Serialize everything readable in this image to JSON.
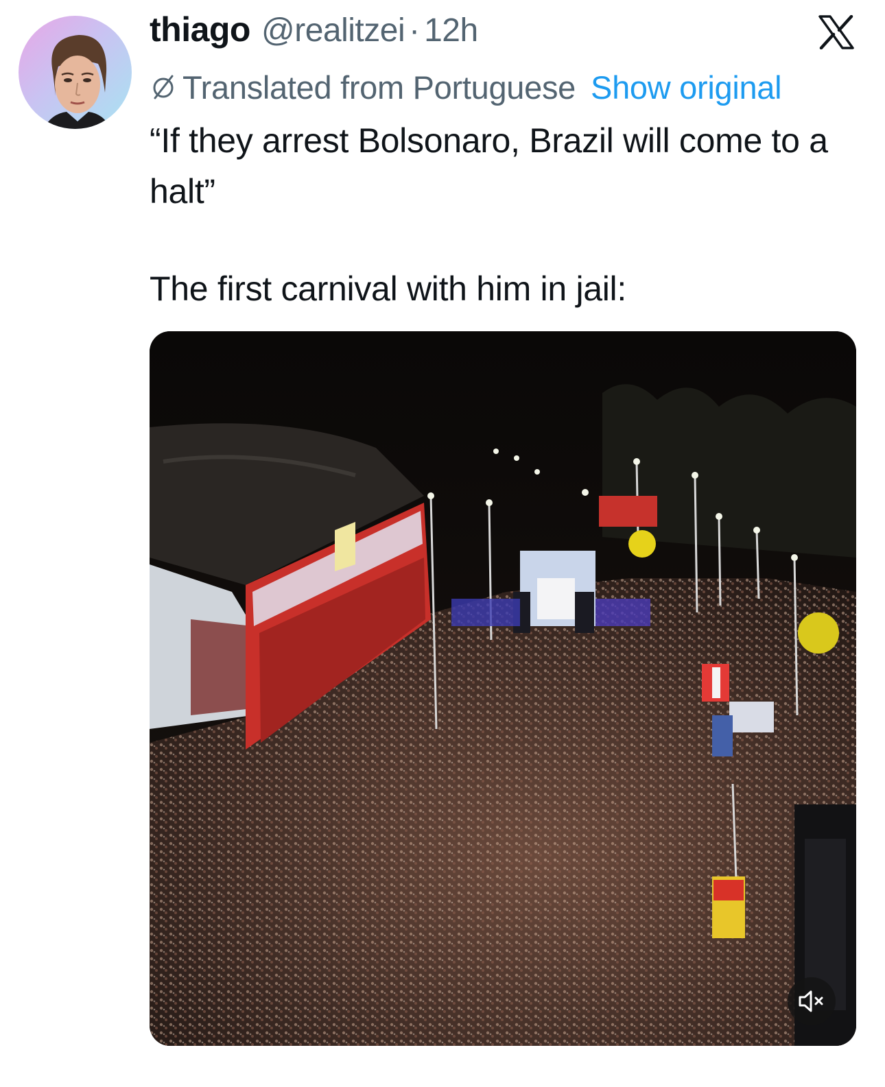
{
  "tweet": {
    "display_name": "thiago",
    "handle": "@realitzei",
    "separator": "·",
    "time": "12h",
    "translation_label": "Translated from Portuguese",
    "show_original_label": "Show original",
    "text_quote": "“If they arrest Bolsonaro, Brazil will come to a halt”",
    "text_line": "The first carnival with him in jail:"
  },
  "icons": {
    "platform": "x-logo-icon",
    "translate": "translate-icon",
    "mute": "speaker-muted-icon"
  },
  "colors": {
    "link": "#1d9bf0",
    "secondary_text": "#536471",
    "primary_text": "#0f1419"
  }
}
